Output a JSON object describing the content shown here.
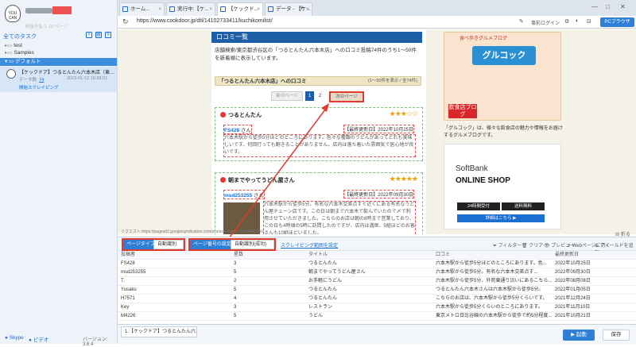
{
  "sidebar": {
    "logo_text": "YOU CAN",
    "username_subtitle": "料金を払う 10 ページ",
    "all_tasks_label": "全てのタスク",
    "tree": [
      {
        "label": "test"
      },
      {
        "label": "Samples"
      }
    ],
    "default_label": "デフォルト",
    "task": {
      "title": "【ケックドア】つるとんたん六本木店（東…",
      "count_label": "データ数:",
      "count_value": "74",
      "time": "2023-01-12 16:38:51",
      "action": "開始スクレイピング"
    },
    "footer_skype": "Skype",
    "footer_video": "ビデオ",
    "version": "バージョン: 3.6.4"
  },
  "browser": {
    "tabs": [
      {
        "label": "ホーム..."
      },
      {
        "label": "実行中:【ケ..."
      },
      {
        "label": "【ケックド..."
      },
      {
        "label": "データ - 【ケ..."
      }
    ],
    "url": "https://www.cookdoor.jp/dtl/14102733411/kuchikomilist/",
    "login_label": "事前ログイン",
    "pc_browser_label": "PCブラウザ"
  },
  "page": {
    "heading": "口コミ一覧",
    "description": "店舗検索/東京都渋谷区の「つるとんたん六本木店」への口コミ投稿74件のうち1〜50件を新着順に表示しています。",
    "section_title": "「つるとんたん六本木店」への口コミ",
    "section_range": "(1〜50件を表示 / 全74件)",
    "pager": {
      "prev": "前のページ",
      "p1": "1",
      "p2": "2",
      "next": "次のページ"
    },
    "reviews": [
      {
        "shop": "つるとんたん",
        "stars": "★★★☆☆",
        "user": "FS428",
        "san": "さん",
        "date": "【最終更新日】2022年10月25日",
        "text": "六本木駅から徒歩5分ほどのところにあります。色々な種類のうどんがあってどれも美味しいです。何回行っても飽きることがありません。店内は落ち着いた雰囲気で居心地が良いです。"
      },
      {
        "shop": "朝までやってうどん屋さん",
        "stars": "★★★★★",
        "user": "msd253255",
        "san": "さん",
        "date": "【最終更新日】2022年09月30日",
        "text": "六本木駅から徒歩5分。有名な六本木交差点すぐ近くにある有名なうどん屋チェーン店です。この日は朝まで六本木で飲んでいたので〆で利用させていただきました。こちらのお店は朝の8時まで営業しており、この日も4時頃の5時に訪問したのですが、店内は満席、5組ほどのお客さんも10組ほどいました。"
      }
    ],
    "right": {
      "banner_top": "食べ歩きグルメブログ",
      "banner_sign": "グルコック",
      "banner_badge": "飲食店ブログ",
      "text": "「グルコック」は、様々な飲食店の魅力や情報をお届けするグルメブログです。",
      "sb_logo": "SoftBank",
      "sb_shop": "ONLINE SHOP",
      "sb_btn1": "24時間受付",
      "sb_btn2": "送料無料",
      "sb_btn3": "詳細はこちら ▶"
    },
    "status_url": "リクエスト:https://pagead2.googlesyndication.com/pcs/activeview?xai=AKAOjstc...",
    "fold_label": "折る"
  },
  "toolbar": {
    "page_type_label": "ページタイプ",
    "page_type_value": "自動識別",
    "page_num_label": "ページ番号の設定",
    "page_num_value": "自動識別(成功)",
    "scrape_link": "スクレイピング範囲を設定",
    "filter": "フィルター",
    "clear": "クリア",
    "preview": "プレビュー",
    "web_page_go": "Webページに行く",
    "add_field": "フィールドを追加"
  },
  "table": {
    "headers": [
      "投稿者",
      "星数",
      "タイトル",
      "口コミ",
      "最終更新日"
    ],
    "rows": [
      [
        "FS428",
        "3",
        "つるとんたん",
        "六本木駅から徒歩5分ほどのところにあります。色...",
        "2022年10月25日"
      ],
      [
        "msd253255",
        "5",
        "朝までやってうどん屋さん",
        "六本木駅から徒歩5分。有名な六本木交差点す...",
        "2022年09月30日"
      ],
      [
        "T.",
        "2",
        "お手軽にうどん",
        "六本木駅から徒歩5分、外苑東通り沿いにあるこちら...",
        "2022年08月08日"
      ],
      [
        "Yusaku",
        "5",
        "つるとんたん",
        "つるとんたん六本木さんは六本木駅から徒歩5分。",
        "2022年01月05日"
      ],
      [
        "H7571",
        "4",
        "つるとんたん",
        "こちらのお店は、六本木駅から徒歩5分くらいです。",
        "2021年12月24日"
      ],
      [
        "Key",
        "3",
        "レストラン",
        "六本木駅から徒歩5分くらいのところにあります。",
        "2021年11月10日"
      ],
      [
        "M4226",
        "5",
        "うどん",
        "東京メトロ日比谷線の六本木駅から徒歩で約5分程度...",
        "2021年10月21日"
      ]
    ]
  },
  "statusbar": {
    "task_tab": "1.【ケックドア】つるとんたん六...",
    "run_label": "▶ 起動",
    "save_label": "保存"
  },
  "colors": {
    "accent": "#2f7fd6",
    "highlight": "#e03b2c",
    "heading": "#1c5fa7"
  }
}
